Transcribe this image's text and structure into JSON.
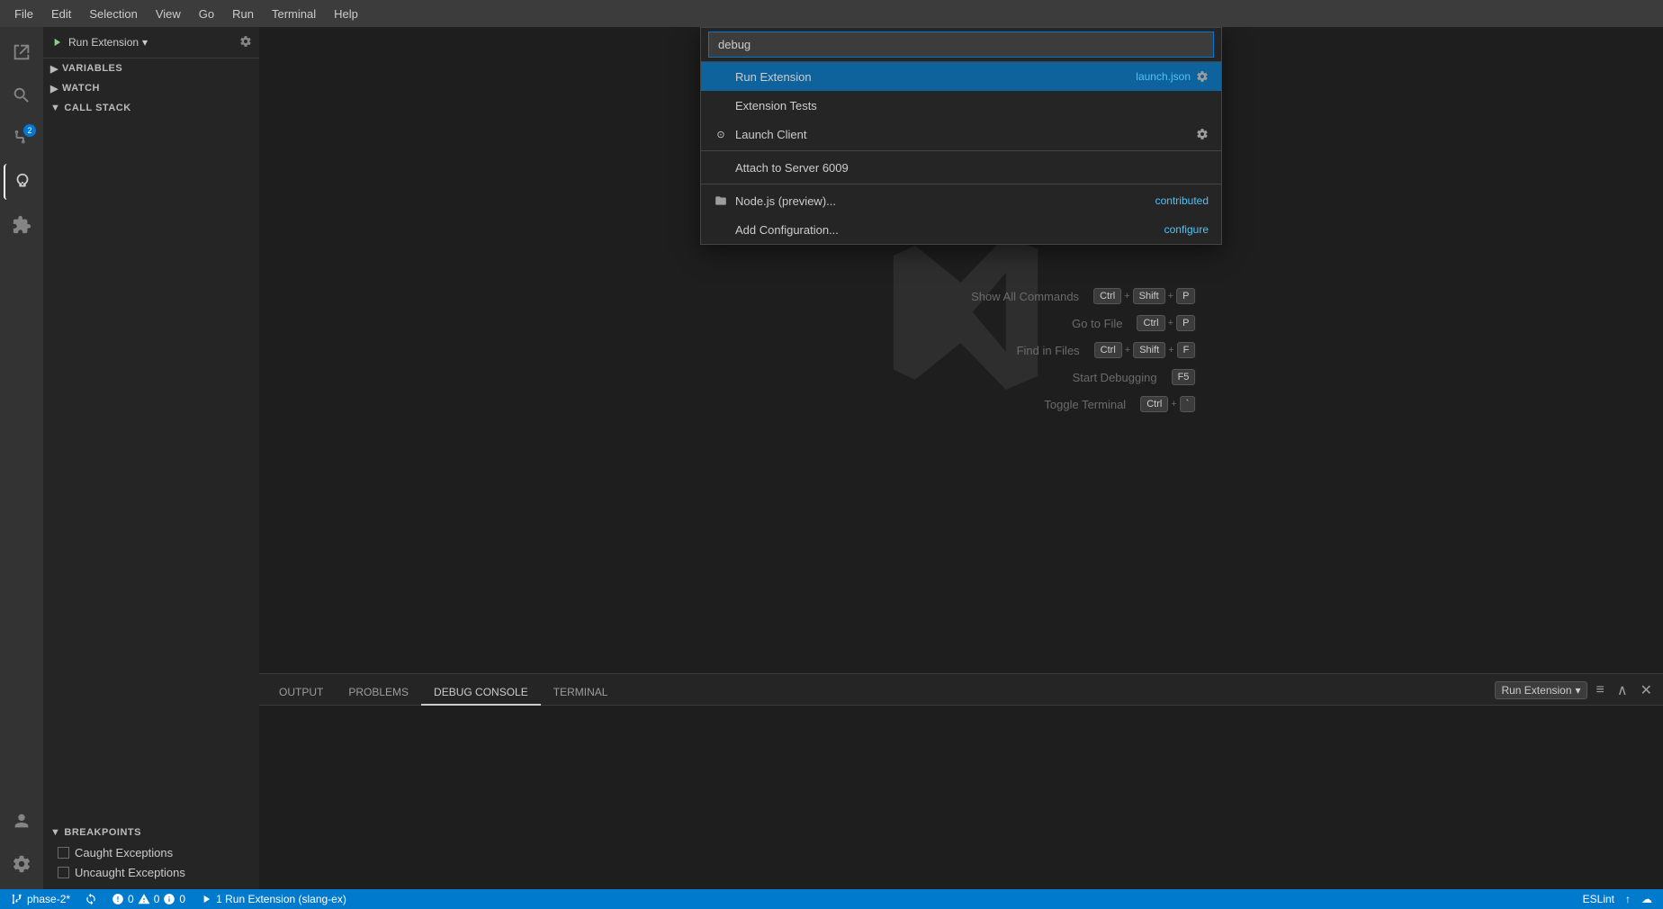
{
  "menubar": {
    "items": [
      "File",
      "Edit",
      "Selection",
      "View",
      "Go",
      "Run",
      "Terminal",
      "Help"
    ]
  },
  "debug_toolbar": {
    "run_label": "Run Extension",
    "run_dropdown": "▾",
    "gear_icon": "⚙"
  },
  "sidebar": {
    "variables_label": "VARIABLES",
    "watch_label": "WATCH",
    "call_stack_label": "CALL STACK",
    "breakpoints_label": "BREAKPOINTS",
    "breakpoints": [
      {
        "label": "Caught Exceptions",
        "checked": false
      },
      {
        "label": "Uncaught Exceptions",
        "checked": false
      }
    ]
  },
  "command_palette": {
    "input_value": "debug",
    "input_placeholder": "debug",
    "items": [
      {
        "id": "run-extension",
        "label": "Run Extension",
        "right_label": "launch.json",
        "right_gear": true,
        "selected": true,
        "icon": null
      },
      {
        "id": "extension-tests",
        "label": "Extension Tests",
        "right_label": null,
        "right_gear": false,
        "selected": false,
        "icon": null
      },
      {
        "id": "launch-client",
        "label": "Launch Client",
        "right_label": null,
        "right_gear": true,
        "selected": false,
        "icon": null
      },
      {
        "id": "attach-server",
        "label": "Attach to Server 6009",
        "right_label": null,
        "right_gear": false,
        "selected": false,
        "icon": null
      },
      {
        "id": "nodejs-preview",
        "label": "Node.js (preview)...",
        "right_label": "contributed",
        "right_gear": false,
        "selected": false,
        "icon": "folder"
      },
      {
        "id": "add-configuration",
        "label": "Add Configuration...",
        "right_label": "configure",
        "right_gear": false,
        "selected": false,
        "icon": null
      }
    ]
  },
  "shortcuts": [
    {
      "label": "Show All Commands",
      "keys": [
        "Ctrl",
        "+",
        "Shift",
        "+",
        "P"
      ]
    },
    {
      "label": "Go to File",
      "keys": [
        "Ctrl",
        "+",
        "P"
      ]
    },
    {
      "label": "Find in Files",
      "keys": [
        "Ctrl",
        "+",
        "Shift",
        "+",
        "F"
      ]
    },
    {
      "label": "Start Debugging",
      "keys": [
        "F5"
      ]
    },
    {
      "label": "Toggle Terminal",
      "keys": [
        "Ctrl",
        "+",
        "`"
      ]
    }
  ],
  "panel": {
    "tabs": [
      "OUTPUT",
      "PROBLEMS",
      "DEBUG CONSOLE",
      "TERMINAL"
    ],
    "active_tab": "DEBUG CONSOLE",
    "dropdown_label": "Run Extension",
    "actions": [
      "≡",
      "∧",
      "✕"
    ]
  },
  "status_bar": {
    "branch": "phase-2*",
    "sync_icon": "↻",
    "errors": "0",
    "warnings": "0",
    "info": "0",
    "run_label": "1  Run Extension (slang-ex)",
    "right_items": [
      "ESLint",
      "↑",
      "☁"
    ]
  },
  "activity_bar": {
    "icons": [
      {
        "name": "explorer",
        "symbol": "⎘",
        "active": false
      },
      {
        "name": "search",
        "symbol": "🔍",
        "active": false
      },
      {
        "name": "source-control",
        "symbol": "⎇",
        "active": false,
        "badge": "2"
      },
      {
        "name": "debug",
        "symbol": "▷",
        "active": true
      },
      {
        "name": "extensions",
        "symbol": "⧉",
        "active": false
      }
    ],
    "bottom_icons": [
      {
        "name": "account",
        "symbol": "👤"
      },
      {
        "name": "settings",
        "symbol": "⚙"
      }
    ]
  }
}
